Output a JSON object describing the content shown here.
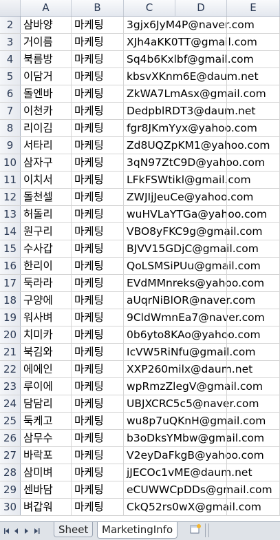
{
  "columns": [
    "A",
    "B",
    "C",
    "D",
    "E"
  ],
  "rows": [
    {
      "num": "2",
      "name": "삼바양",
      "dept": "마케팅",
      "email": "3gjx6JyM4P@naver.com"
    },
    {
      "num": "3",
      "name": "거이름",
      "dept": "마케팅",
      "email": "XJh4aKK0TT@gmail.com"
    },
    {
      "num": "4",
      "name": "북름방",
      "dept": "마케팅",
      "email": "Sq4b6Kxlbf@gmail.com"
    },
    {
      "num": "5",
      "name": "이담거",
      "dept": "마케팅",
      "email": "kbsvXKnm6E@daum.net"
    },
    {
      "num": "6",
      "name": "돌엔바",
      "dept": "마케팅",
      "email": "ZkWA7LmAsx@gmail.com"
    },
    {
      "num": "7",
      "name": "이천카",
      "dept": "마케팅",
      "email": "DedpblRDT3@daum.net"
    },
    {
      "num": "8",
      "name": "리이김",
      "dept": "마케팅",
      "email": "fgr8JKmYyx@yahoo.com"
    },
    {
      "num": "9",
      "name": "서타리",
      "dept": "마케팅",
      "email": "Zd8UQZpKM1@yahoo.com"
    },
    {
      "num": "10",
      "name": "삼자구",
      "dept": "마케팅",
      "email": "3qN97ZtC9D@yahoo.com"
    },
    {
      "num": "11",
      "name": "이치서",
      "dept": "마케팅",
      "email": "LFkFSWtikl@gmail.com"
    },
    {
      "num": "12",
      "name": "돌천셀",
      "dept": "마케팅",
      "email": "ZWJIjJeuCe@yahoo.com"
    },
    {
      "num": "13",
      "name": "허돌리",
      "dept": "마케팅",
      "email": "wuHVLaYTGa@yahoo.com"
    },
    {
      "num": "14",
      "name": "원구리",
      "dept": "마케팅",
      "email": "VBO8yFKC9g@gmail.com"
    },
    {
      "num": "15",
      "name": "수사갑",
      "dept": "마케팅",
      "email": "BJVV15GDjC@gmail.com"
    },
    {
      "num": "16",
      "name": "한리이",
      "dept": "마케팅",
      "email": "QoLSMSiPUu@gmail.com"
    },
    {
      "num": "17",
      "name": "둑라라",
      "dept": "마케팅",
      "email": "EVdMMnreks@yahoo.com"
    },
    {
      "num": "18",
      "name": "구양에",
      "dept": "마케팅",
      "email": "aUqrNiBlOR@naver.com"
    },
    {
      "num": "19",
      "name": "워사벼",
      "dept": "마케팅",
      "email": "9CldWmnEa7@naver.com"
    },
    {
      "num": "20",
      "name": "치미카",
      "dept": "마케팅",
      "email": "0b6yto8KAo@yahoo.com"
    },
    {
      "num": "21",
      "name": "북김와",
      "dept": "마케팅",
      "email": "IcVW5RiNfu@gmail.com"
    },
    {
      "num": "22",
      "name": "에에인",
      "dept": "마케팅",
      "email": "XXP260milx@daum.net"
    },
    {
      "num": "23",
      "name": "루이에",
      "dept": "마케팅",
      "email": "wpRmzZlegV@gmail.com"
    },
    {
      "num": "24",
      "name": "담담리",
      "dept": "마케팅",
      "email": "UBJXCRC5c5@naver.com"
    },
    {
      "num": "25",
      "name": "둑케고",
      "dept": "마케팅",
      "email": "wu8p7uQKnH@gmail.com"
    },
    {
      "num": "26",
      "name": "삼무수",
      "dept": "마케팅",
      "email": "b3oDksYMbw@gmail.com"
    },
    {
      "num": "27",
      "name": "바락포",
      "dept": "마케팅",
      "email": "V2eyDaFkgB@yahoo.com"
    },
    {
      "num": "28",
      "name": "삼미벼",
      "dept": "마케팅",
      "email": "jJECOc1vME@daum.net"
    },
    {
      "num": "29",
      "name": "센바담",
      "dept": "마케팅",
      "email": "eCUWWCpDDs@gmail.com"
    },
    {
      "num": "30",
      "name": "벼갑워",
      "dept": "마케팅",
      "email": "CkQ52rs0wX@gmail.com"
    }
  ],
  "tabs": {
    "sheet1": "Sheet",
    "active": "MarketingInfo"
  },
  "colors": {
    "header_bg": "#e4e8ef",
    "gridline": "#d4d4d4",
    "tabbar_bg": "#dfe3e8"
  }
}
